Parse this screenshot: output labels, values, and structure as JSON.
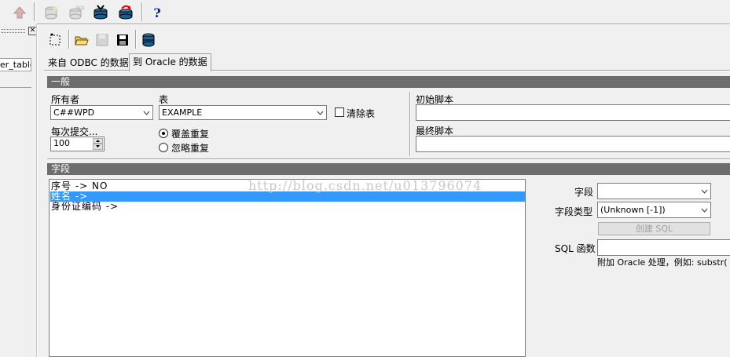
{
  "left": {
    "tree_item": "er_table"
  },
  "tabs": [
    "来自 ODBC 的数据",
    "到 Oracle 的数据"
  ],
  "general": {
    "header": "一般",
    "owner_label": "所有者",
    "owner_value": "C##WPD",
    "table_label": "表",
    "table_value": "EXAMPLE",
    "clear_table_label": "清除表",
    "commit_label": "每次提交...",
    "commit_value": "100",
    "overwrite_label": "覆盖重复",
    "ignore_label": "忽略重复",
    "init_script_label": "初始脚本",
    "final_script_label": "最终脚本"
  },
  "fields": {
    "header": "字段",
    "items": [
      "序号 -> NO",
      "姓名 ->",
      "身份证编码 ->"
    ],
    "selected_index": 1,
    "field_label": "字段",
    "field_value": "",
    "field_type_label": "字段类型",
    "field_type_value": "(Unknown [-1])",
    "create_sql_label": "创建 SQL",
    "sql_func_label": "SQL 函数",
    "sql_func_value": "",
    "hint": "附加 Oracle 处理，例如:  substr("
  },
  "watermark": "http://blog.csdn.net/u013796074",
  "icons": {
    "main_toolbar": [
      "up-arrow-icon",
      "database-plus-icon",
      "database-sql-icon",
      "database-connect-icon",
      "database-refresh-icon",
      "help-icon"
    ],
    "sub_toolbar": [
      "new-selection-icon",
      "open-folder-icon",
      "save-disabled-icon",
      "save-icon",
      "database-cylinder-icon"
    ]
  }
}
